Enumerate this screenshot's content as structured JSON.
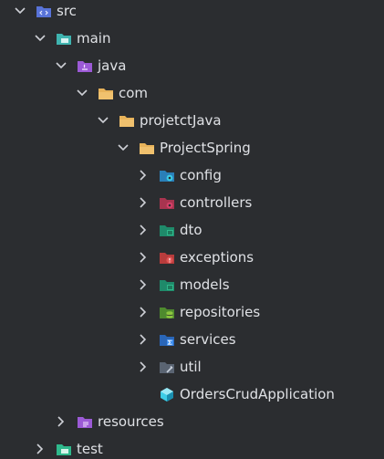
{
  "tree": {
    "src": "src",
    "main": "main",
    "java": "java",
    "com": "com",
    "projetctJava": "projetctJava",
    "ProjectSpring": "ProjectSpring",
    "config": "config",
    "controllers": "controllers",
    "dto": "dto",
    "exceptions": "exceptions",
    "models": "models",
    "repositories": "repositories",
    "services": "services",
    "util": "util",
    "OrdersCrudApplication": "OrdersCrudApplication",
    "resources": "resources",
    "test": "test"
  },
  "colors": {
    "background": "#2b2d30",
    "text": "#dfe1e5",
    "chevron": "#ced0d6",
    "folder_yellow": "#e8b35a",
    "folder_blue": "#5873d8",
    "folder_teal": "#3fb4b0",
    "folder_purple": "#9c5ad6",
    "folder_green": "#2fb98c",
    "badge_cyan": "#3ccce6",
    "badge_pink": "#d6416a",
    "badge_red": "#e05555",
    "badge_green": "#4aa14e",
    "badge_lime": "#8cc63f",
    "badge_blue": "#3d8ef0"
  }
}
